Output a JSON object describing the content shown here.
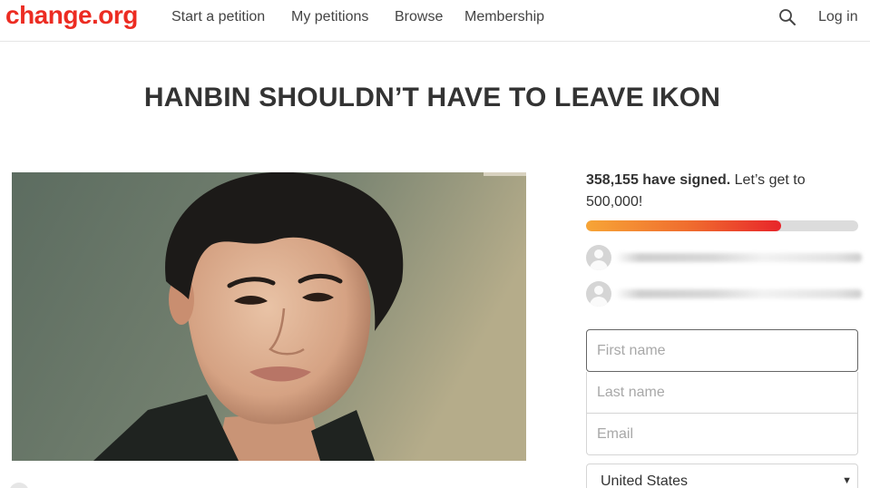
{
  "header": {
    "logo": "change.org",
    "nav": [
      "Start a petition",
      "My petitions",
      "Browse",
      "Membership"
    ],
    "search_icon": "search-icon",
    "login_label": "Log in"
  },
  "petition": {
    "title": "HANBIN SHOULDN’T HAVE TO LEAVE IKON",
    "photo_icon": "person-photo"
  },
  "signatures": {
    "count_text": "358,155 have signed.",
    "goal_text": "Let’s get to 500,000!",
    "signed": 358155,
    "goal": 500000,
    "progress_fraction": 0.7163
  },
  "form": {
    "first_name_placeholder": "First name",
    "last_name_placeholder": "Last name",
    "email_placeholder": "Email",
    "country_selected": "United States"
  },
  "colors": {
    "brand": "#ec2c22",
    "progress_start": "#f7a537",
    "progress_end": "#e8252a"
  }
}
